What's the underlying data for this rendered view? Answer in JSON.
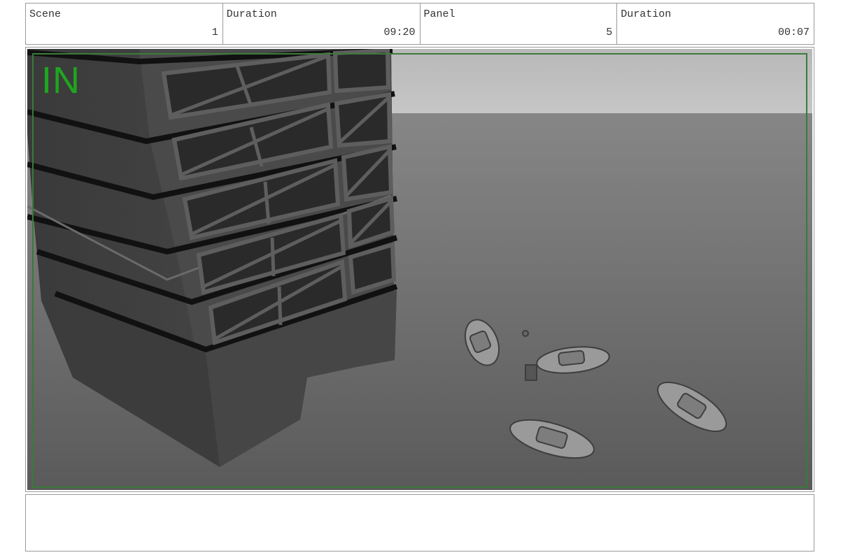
{
  "info": {
    "scene_label": "Scene",
    "scene_value": "1",
    "scene_duration_label": "Duration",
    "scene_duration_value": "09:20",
    "panel_label": "Panel",
    "panel_value": "5",
    "panel_duration_label": "Duration",
    "panel_duration_value": "00:07"
  },
  "viewport": {
    "marker_label": "IN",
    "marker_color": "#1fa51f",
    "frame_color": "#3a7a3a"
  },
  "notes": {
    "text": ""
  }
}
